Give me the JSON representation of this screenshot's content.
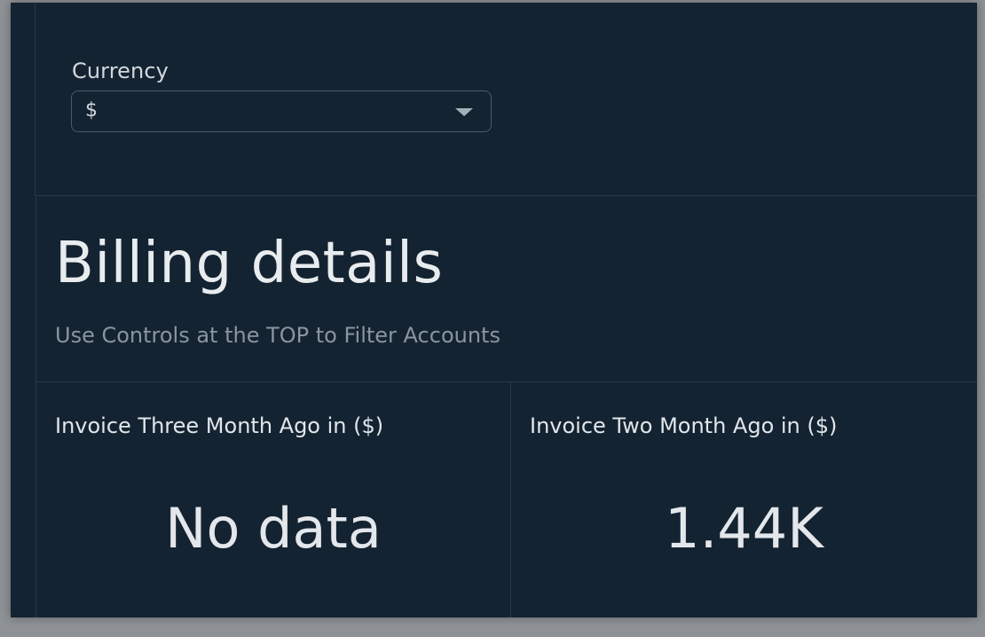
{
  "controls": {
    "currency_label": "Currency",
    "currency_value": "$"
  },
  "header": {
    "title": "Billing details",
    "subtitle": "Use Controls at the TOP to Filter Accounts"
  },
  "kpis": [
    {
      "title": "Invoice Three Month Ago in ($)",
      "value": "No data"
    },
    {
      "title": "Invoice Two Month Ago in ($)",
      "value": "1.44K"
    }
  ],
  "colors": {
    "background": "#142331",
    "divider": "#26394a",
    "text_primary": "#e3e7eb",
    "text_muted": "#8a95a0"
  },
  "icons": {
    "dropdown_caret": "chevron-down-icon"
  }
}
